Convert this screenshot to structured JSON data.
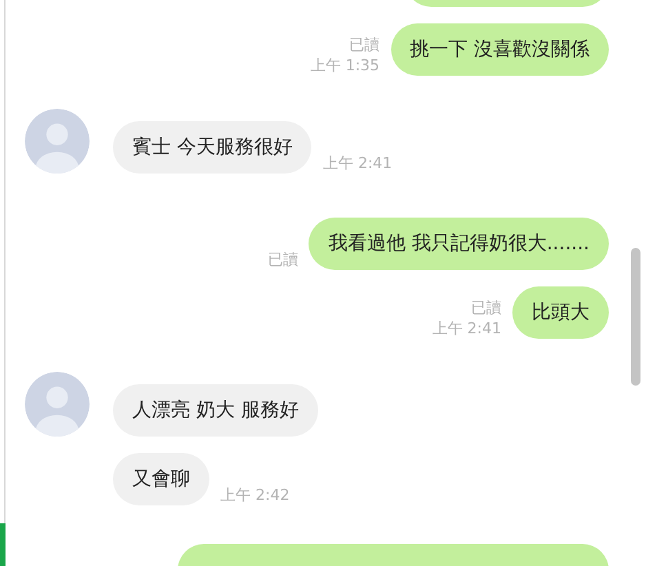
{
  "messages": [
    {
      "kind": "cut-top"
    },
    {
      "kind": "sent",
      "read": "已讀",
      "time": "上午 1:35",
      "text": "挑一下  沒喜歡沒關係"
    },
    {
      "kind": "received",
      "avatar": true,
      "time": "上午 2:41",
      "text": "賓士  今天服務很好"
    },
    {
      "kind": "sent",
      "read": "已讀",
      "text": "我看過他  我只記得奶很大......."
    },
    {
      "kind": "sent",
      "read": "已讀",
      "time": "上午 2:41",
      "text": "比頭大"
    },
    {
      "kind": "received",
      "avatar": true,
      "text": "人漂亮 奶大 服務好"
    },
    {
      "kind": "received",
      "avatar": false,
      "time": "上午 2:42",
      "text": "又會聊"
    },
    {
      "kind": "cut-bottom"
    }
  ]
}
